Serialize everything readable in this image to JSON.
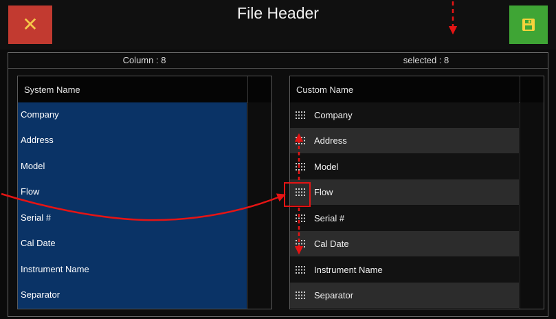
{
  "header": {
    "title": "File Header",
    "close_icon": "close-icon",
    "save_icon": "save-floppy-icon"
  },
  "system_table": {
    "count_label": "Column : 8",
    "header": "System Name",
    "items": [
      {
        "label": "Company"
      },
      {
        "label": "Address"
      },
      {
        "label": "Model"
      },
      {
        "label": "Flow"
      },
      {
        "label": "Serial #"
      },
      {
        "label": "Cal Date"
      },
      {
        "label": "Instrument Name"
      },
      {
        "label": "Separator"
      }
    ]
  },
  "custom_table": {
    "count_label": "selected : 8",
    "header": "Custom Name",
    "items": [
      {
        "label": "Company"
      },
      {
        "label": "Address"
      },
      {
        "label": "Model"
      },
      {
        "label": "Flow"
      },
      {
        "label": "Serial #"
      },
      {
        "label": "Cal Date"
      },
      {
        "label": "Instrument Name"
      },
      {
        "label": "Separator"
      }
    ]
  },
  "colors": {
    "close_bg": "#c23a30",
    "save_bg": "#3fa535",
    "selection_blue": "#0a3366",
    "annotation_red": "#e51414"
  }
}
